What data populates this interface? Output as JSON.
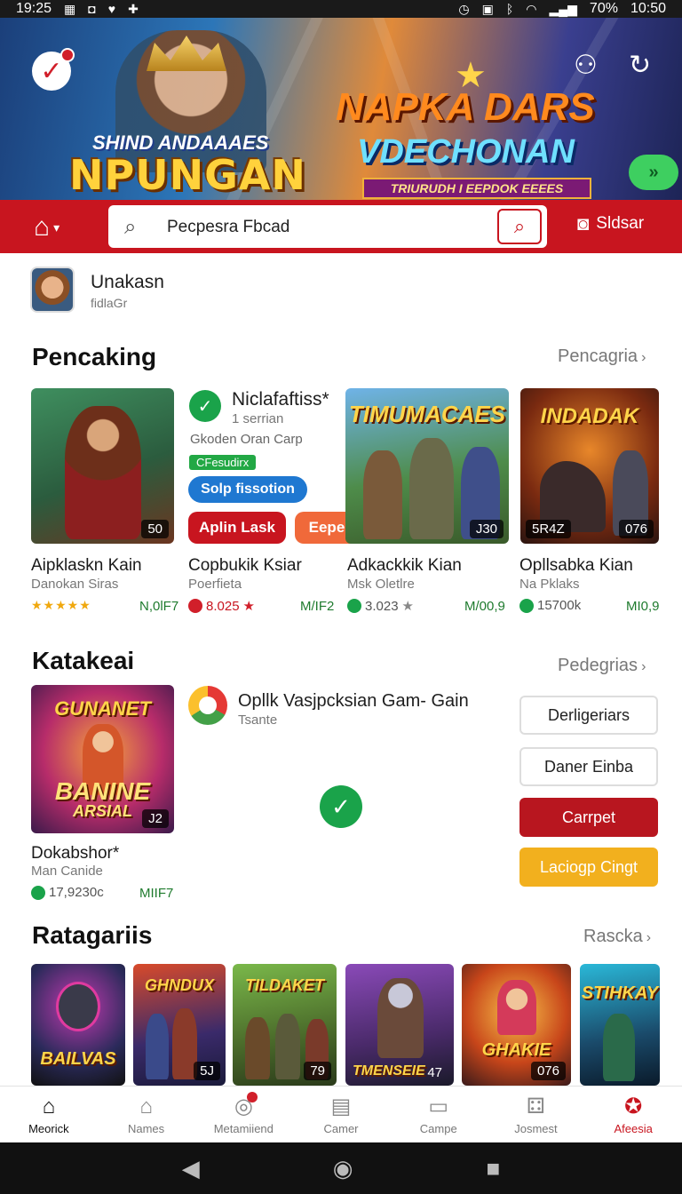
{
  "status": {
    "time_left": "19:25",
    "battery": "70%",
    "time_right": "10:50"
  },
  "banner": {
    "left_subtitle": "SHIND ANDAAAES",
    "left_title": "NPUNGAN",
    "right_title": "NAPKA DARS",
    "right_title2": "VDECHONAN",
    "ribbon": "TRIURUDH I EEPDOK EEEES"
  },
  "search": {
    "placeholder": "Pecpesra Fbcad",
    "store_label": "Sldsar"
  },
  "profile": {
    "name": "Unakasn",
    "sub": "fidlaGr"
  },
  "section1": {
    "title": "Pencaking",
    "more": "Pencagria",
    "cards": [
      {
        "img_title": "",
        "badge": "50",
        "name": "Aipklaskn Kain",
        "sub": "Danokan Siras",
        "rating": "★★★★★",
        "price": "N,0lF7"
      },
      {
        "name": "Copbukik Ksiar",
        "sub": "Poerfieta",
        "rating": "8.025",
        "price": "M/IF2"
      },
      {
        "img_title": "TIMUMACAES",
        "badge_left": "",
        "badge": "J30",
        "name": "Adkackkik Kian",
        "sub": "Msk Oletlre",
        "rating": "3.023",
        "price": "M/00,9"
      },
      {
        "img_title": "INDADAK",
        "badge_left": "5R4Z",
        "badge": "076",
        "name": "Opllsabka Kian",
        "sub": "Na Pklaks",
        "rating": "15700k",
        "price": "MI0,9"
      }
    ],
    "feature": {
      "title": "Niclafaftiss*",
      "sub": "1 serrian",
      "line": "Gkoden Oran Carp",
      "tag": "CFesudirx",
      "blue_button": "Solp fissotion",
      "red_button": "Aplin Lask",
      "orange_button": "Eepeustam"
    }
  },
  "section2": {
    "title": "Katakeai",
    "more": "Pedegrias",
    "card": {
      "img_title": "BANINE",
      "img_title2": "ARSIAL",
      "top_title": "GUNANET",
      "badge": "J2",
      "name": "Dokabshor*",
      "sub": "Man Canide",
      "rating": "17,9230c",
      "price": "MIIF7"
    },
    "app": {
      "title": "Opllk Vasjpcksian Gam- Gain",
      "sub": "Tsante"
    },
    "buttons": [
      "Derligeriars",
      "Daner Einba",
      "Carrpet",
      "Laciogp Cingt"
    ]
  },
  "section3": {
    "title": "Ratagariis",
    "more": "Rascka",
    "tiles": [
      {
        "title": "BAILVAS",
        "badge": ""
      },
      {
        "title": "GHNDUX",
        "badge": "5J"
      },
      {
        "title": "TILDAKET",
        "badge": "79"
      },
      {
        "title": "TMENSEIE",
        "badge": "47"
      },
      {
        "title": "GHAKIE",
        "badge": "076"
      },
      {
        "title": "STIHKAY",
        "badge": ""
      }
    ]
  },
  "nav": [
    {
      "label": "Meorick"
    },
    {
      "label": "Names"
    },
    {
      "label": "Metamiiend"
    },
    {
      "label": "Camer"
    },
    {
      "label": "Campe"
    },
    {
      "label": "Josmest"
    },
    {
      "label": "Afeesia"
    }
  ],
  "colors": {
    "brand_red": "#c8151f",
    "accent_green": "#1aa34a",
    "accent_blue": "#1f78d1",
    "accent_orange": "#f0693a",
    "accent_yellow": "#f2b01e"
  }
}
